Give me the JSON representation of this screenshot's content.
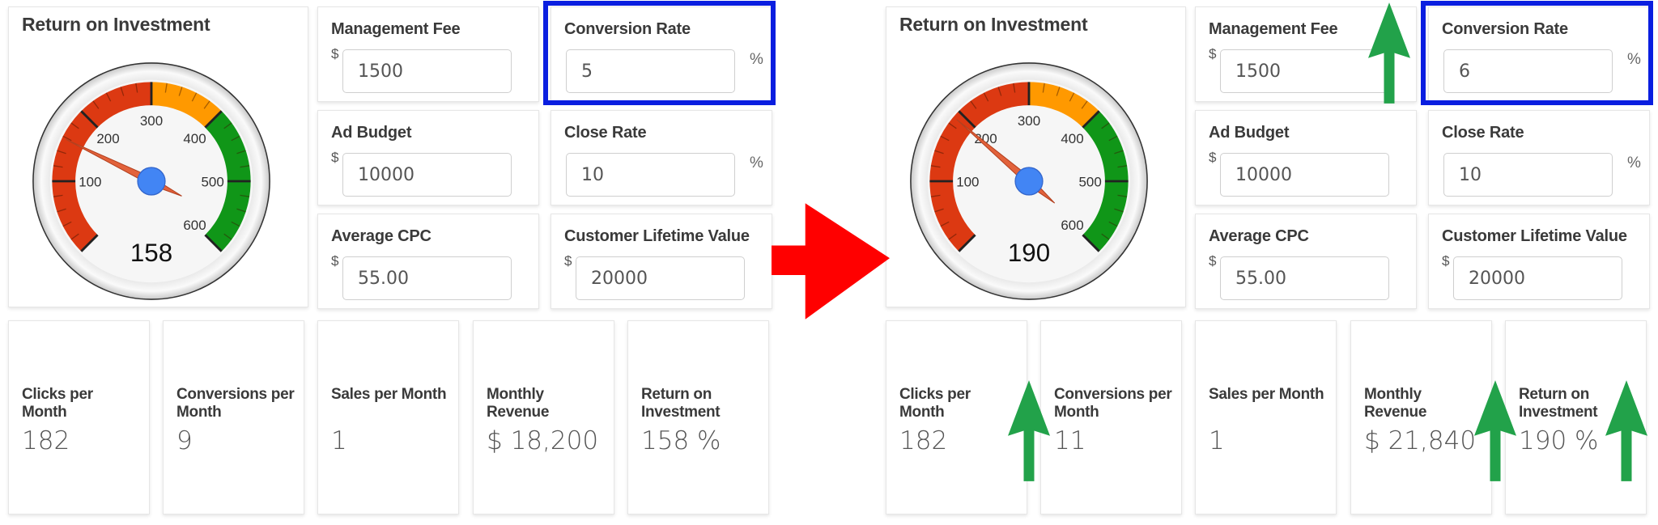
{
  "panels": [
    {
      "id": "before",
      "gauge": {
        "title": "Return on Investment",
        "value": 158,
        "min": 0,
        "max": 600,
        "tick_labels": [
          "100",
          "200",
          "300",
          "400",
          "500",
          "600"
        ],
        "bands": [
          {
            "from": 0,
            "to": 300,
            "color": "#dc3912"
          },
          {
            "from": 300,
            "to": 400,
            "color": "#ff9900"
          },
          {
            "from": 400,
            "to": 600,
            "color": "#109618"
          }
        ]
      },
      "inputs": {
        "management_fee": {
          "label": "Management Fee",
          "prefix": "$",
          "value": "1500"
        },
        "conversion_rate": {
          "label": "Conversion Rate",
          "suffix": "%",
          "value": "5"
        },
        "ad_budget": {
          "label": "Ad Budget",
          "prefix": "$",
          "value": "10000"
        },
        "close_rate": {
          "label": "Close Rate",
          "suffix": "%",
          "value": "10"
        },
        "average_cpc": {
          "label": "Average CPC",
          "prefix": "$",
          "value": "55.00"
        },
        "customer_lifetime_value": {
          "label": "Customer Lifetime Value",
          "prefix": "$",
          "value": "20000"
        }
      },
      "stats": [
        {
          "label": "Clicks per Month",
          "value": "182"
        },
        {
          "label": "Conversions per Month",
          "value": "9"
        },
        {
          "label": "Sales per Month",
          "value": "1"
        },
        {
          "label": "Monthly Revenue",
          "value": "$ 18,200"
        },
        {
          "label": "Return on Investment",
          "value": "158 %"
        }
      ]
    },
    {
      "id": "after",
      "gauge": {
        "title": "Return on Investment",
        "value": 190,
        "min": 0,
        "max": 600,
        "tick_labels": [
          "100",
          "200",
          "300",
          "400",
          "500",
          "600"
        ],
        "bands": [
          {
            "from": 0,
            "to": 300,
            "color": "#dc3912"
          },
          {
            "from": 300,
            "to": 400,
            "color": "#ff9900"
          },
          {
            "from": 400,
            "to": 600,
            "color": "#109618"
          }
        ]
      },
      "inputs": {
        "management_fee": {
          "label": "Management Fee",
          "prefix": "$",
          "value": "1500"
        },
        "conversion_rate": {
          "label": "Conversion Rate",
          "suffix": "%",
          "value": "6"
        },
        "ad_budget": {
          "label": "Ad Budget",
          "prefix": "$",
          "value": "10000"
        },
        "close_rate": {
          "label": "Close Rate",
          "suffix": "%",
          "value": "10"
        },
        "average_cpc": {
          "label": "Average CPC",
          "prefix": "$",
          "value": "55.00"
        },
        "customer_lifetime_value": {
          "label": "Customer Lifetime Value",
          "prefix": "$",
          "value": "20000"
        }
      },
      "stats": [
        {
          "label": "Clicks per Month",
          "value": "182"
        },
        {
          "label": "Conversions per Month",
          "value": "11"
        },
        {
          "label": "Sales per Month",
          "value": "1"
        },
        {
          "label": "Monthly Revenue",
          "value": "$ 21,840"
        },
        {
          "label": "Return on Investment",
          "value": "190 %"
        }
      ]
    }
  ],
  "annotations": {
    "highlight_color": "#0a1ee0",
    "transition_arrow_color": "#ff0000",
    "increase_arrow_color": "#22a24a"
  }
}
